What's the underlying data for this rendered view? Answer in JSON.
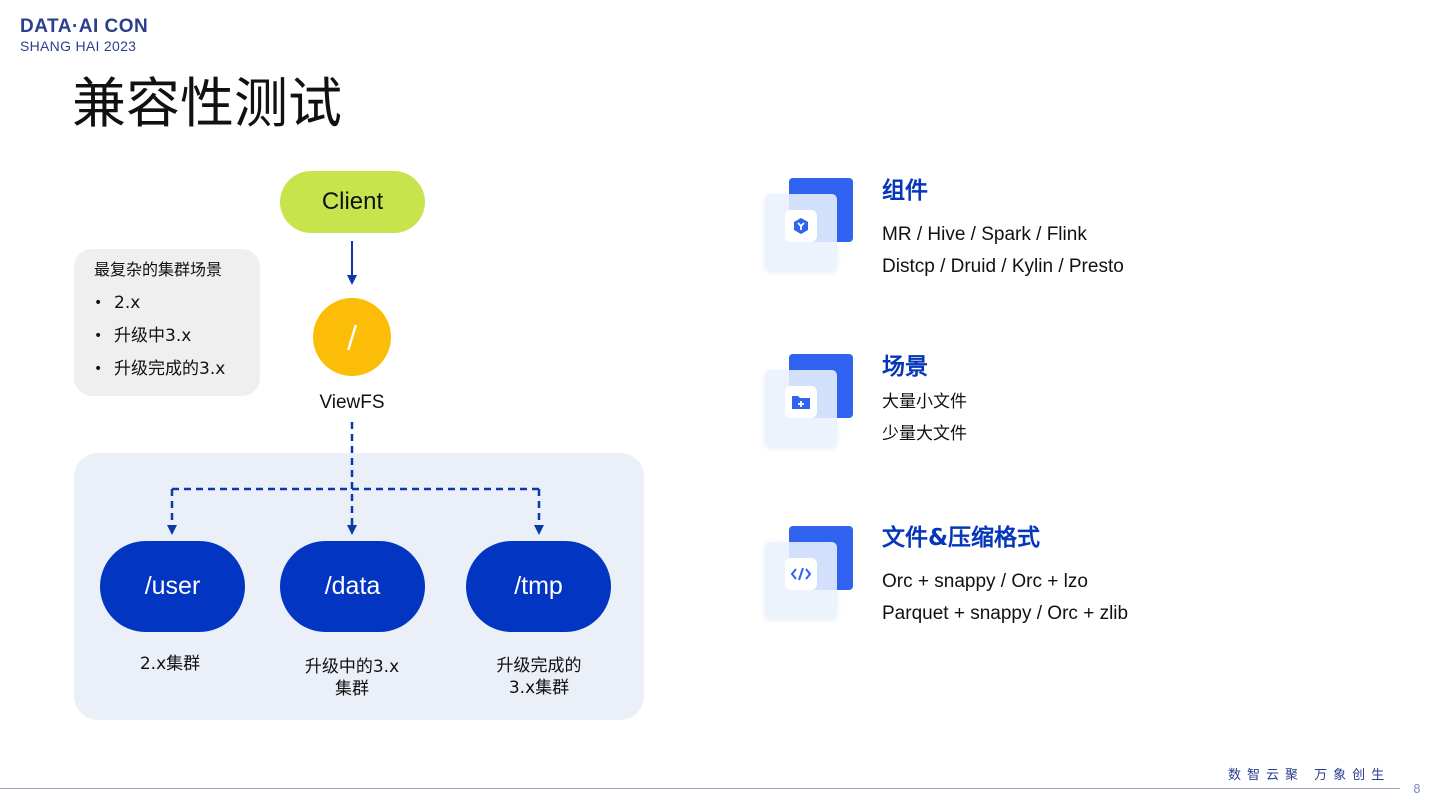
{
  "logo": {
    "line1": "DATA·AI CON",
    "line2": "SHANG HAI 2023"
  },
  "title": "兼容性测试",
  "scenario_box": {
    "title": "最复杂的集群场景",
    "items": [
      "2.x",
      "升级中3.x",
      "升级完成的3.x"
    ],
    "bullet": "•"
  },
  "diagram": {
    "client": "Client",
    "viewfs_symbol": "/",
    "viewfs_label": "ViewFS",
    "mounts": [
      {
        "path": "/user",
        "label_lines": [
          "2.x集群"
        ]
      },
      {
        "path": "/data",
        "label_lines": [
          "升级中的3.x",
          "集群"
        ]
      },
      {
        "path": "/tmp",
        "label_lines": [
          "升级完成的",
          "3.x集群"
        ]
      }
    ],
    "colors": {
      "client": "#c7e44d",
      "viewfs": "#fbbd08",
      "mount": "#0235c2",
      "panel": "#eaeff8",
      "arrow": "#0a3aa8"
    }
  },
  "features": [
    {
      "title": "组件",
      "icon": "component-icon",
      "lines": [
        "MR / Hive / Spark / Flink",
        "Distcp / Druid / Kylin / Presto"
      ]
    },
    {
      "title": "场景",
      "icon": "folder-add-icon",
      "lines": [
        "大量小文件",
        "少量大文件"
      ]
    },
    {
      "title": "文件&压缩格式",
      "icon": "code-icon",
      "lines": [
        "Orc + snappy / Orc + lzo",
        "Parquet + snappy / Orc + zlib"
      ]
    }
  ],
  "footer": {
    "slogan": "数智云聚  万象创生",
    "page": "8"
  }
}
